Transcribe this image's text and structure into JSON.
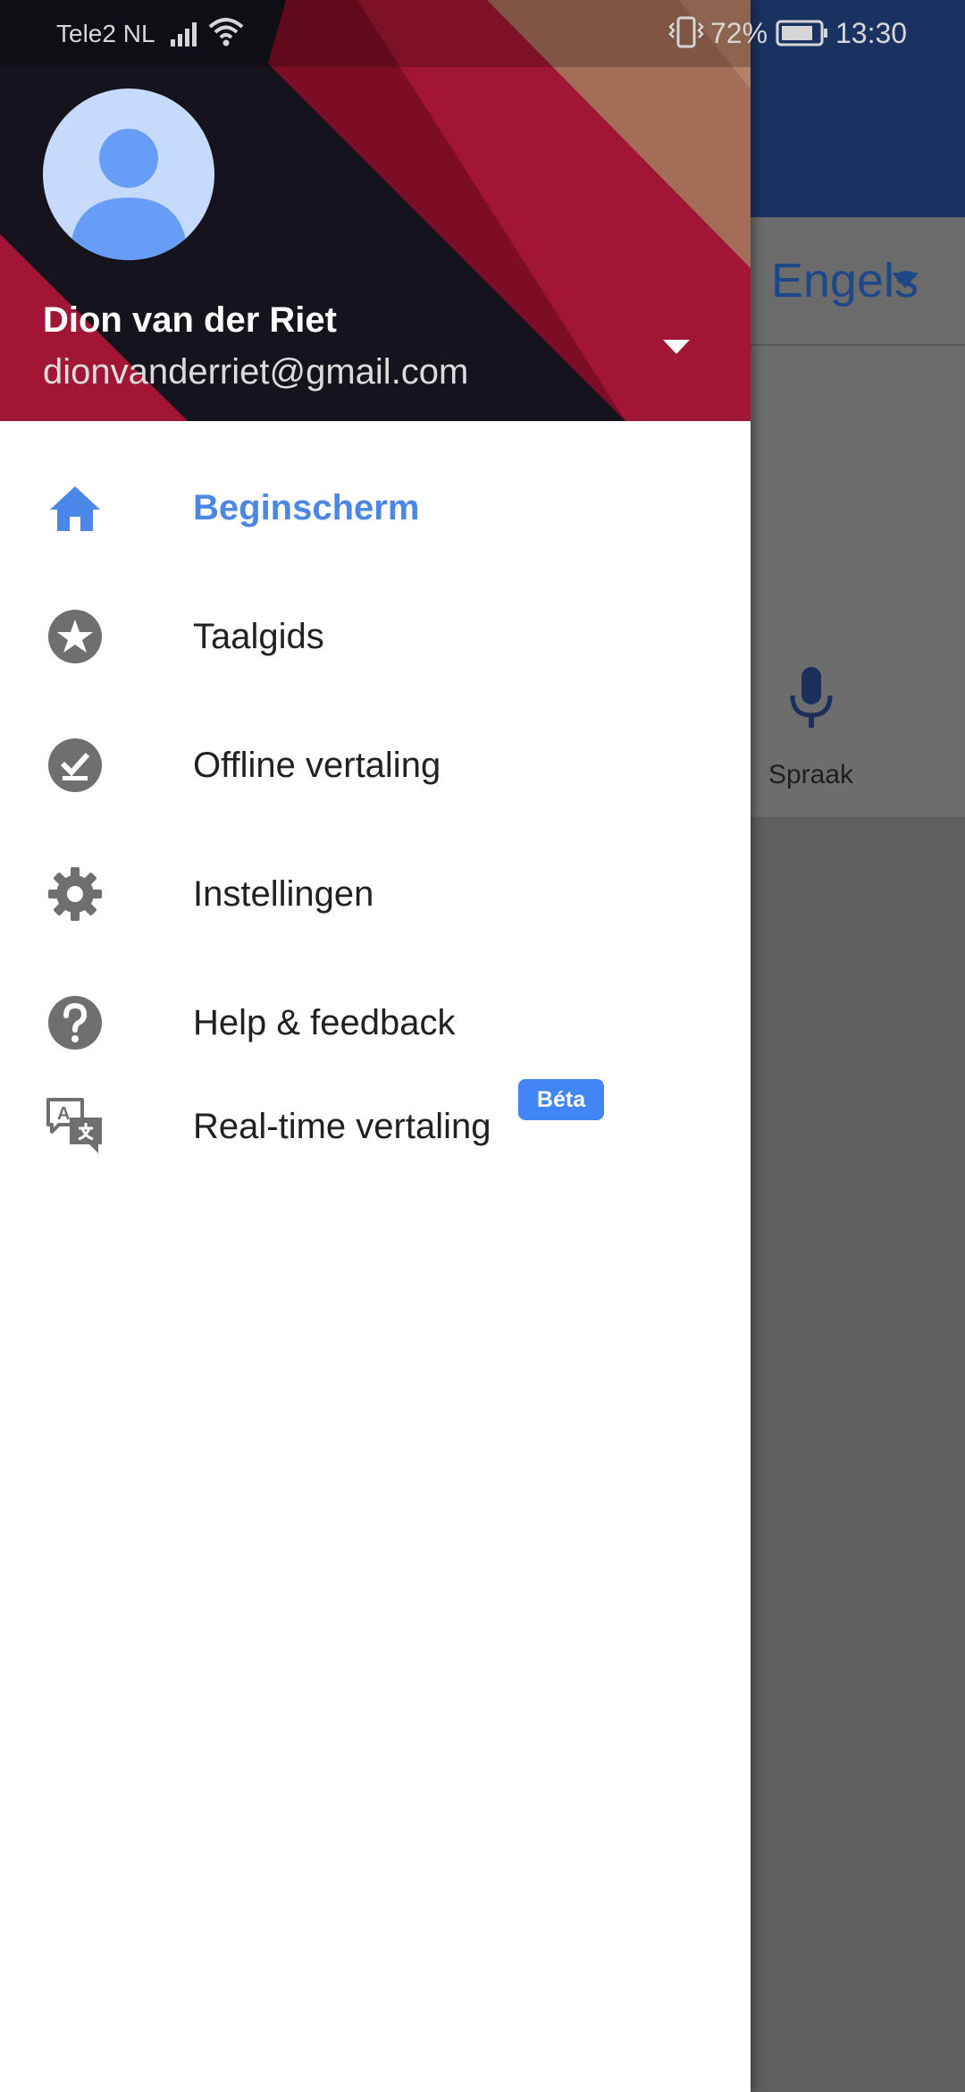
{
  "status_bar": {
    "carrier": "Tele2 NL",
    "battery_percent": "72%",
    "time": "13:30"
  },
  "background_app": {
    "target_language": "Engels",
    "voice_label": "Spraak"
  },
  "drawer": {
    "account": {
      "name": "Dion van der Riet",
      "email": "dionvanderriet@gmail.com"
    },
    "menu": [
      {
        "label": "Beginscherm",
        "icon": "home-icon",
        "active": true
      },
      {
        "label": "Taalgids",
        "icon": "star-circle-icon"
      },
      {
        "label": "Offline vertaling",
        "icon": "offline-check-icon"
      },
      {
        "label": "Instellingen",
        "icon": "gear-icon"
      },
      {
        "label": "Help & feedback",
        "icon": "help-icon"
      },
      {
        "label": "Real-time vertaling",
        "icon": "translate-chat-icon",
        "badge": "Béta"
      }
    ]
  },
  "colors": {
    "accent": "#4b87e6",
    "badge": "#4285f4",
    "icon_grey": "#6f6f6f",
    "app_bar": "#1a3262"
  }
}
